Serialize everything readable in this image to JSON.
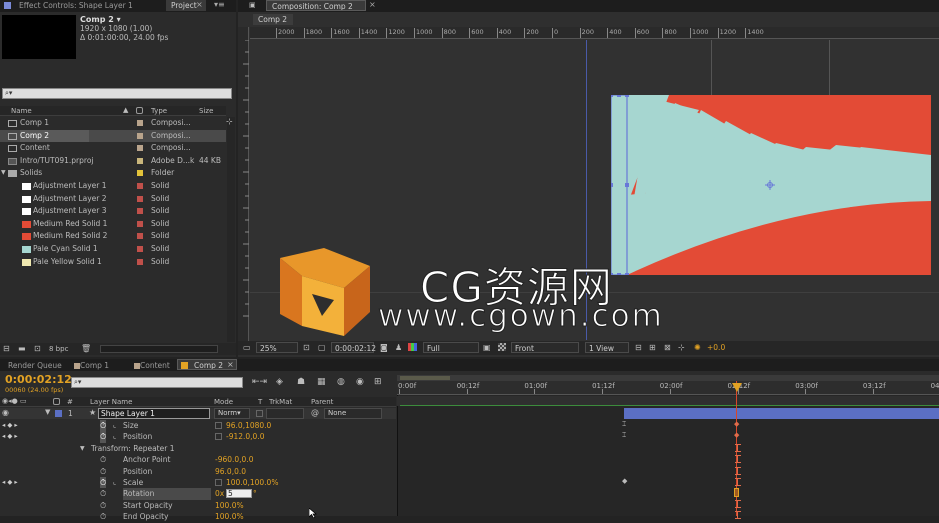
{
  "top_tabs": {
    "effect_controls": "Effect Controls: Shape Layer 1",
    "project": "Project",
    "composition": "Composition: Comp 2",
    "comp_subtab": "Comp 2"
  },
  "comp_info": {
    "name": "Comp 2 ▾",
    "resolution": "1920 x 1080 (1.00)",
    "duration": "Δ 0:01:00:00, 24.00 fps"
  },
  "project_search": {
    "placeholder": "⌕▾"
  },
  "project_columns": {
    "name": "Name",
    "type": "Type",
    "size": "Size"
  },
  "project_items": [
    {
      "name": "Comp 1",
      "type": "Composi...",
      "size": "",
      "swatch": "#b9a48c",
      "icon": "comp-icon",
      "indent": 0
    },
    {
      "name": "Comp 2",
      "type": "Composi...",
      "size": "",
      "swatch": "#b9a48c",
      "icon": "comp-icon",
      "indent": 0,
      "selected": true
    },
    {
      "name": "Content",
      "type": "Composi...",
      "size": "",
      "swatch": "#b9a48c",
      "icon": "comp-icon",
      "indent": 0
    },
    {
      "name": "Intro/TUT091.prproj",
      "type": "Adobe D...k",
      "size": "44 KB",
      "swatch": "#c9b67c",
      "icon": "project-file-icon",
      "indent": 0
    },
    {
      "name": "Solids",
      "type": "Folder",
      "size": "",
      "swatch": "#e3c33a",
      "icon": "folder-icon",
      "indent": 0
    },
    {
      "name": "Adjustment Layer 1",
      "type": "Solid",
      "size": "",
      "swatch": "#c0504a",
      "icon": "solid-white",
      "indent": 1
    },
    {
      "name": "Adjustment Layer 2",
      "type": "Solid",
      "size": "",
      "swatch": "#c0504a",
      "icon": "solid-white",
      "indent": 1
    },
    {
      "name": "Adjustment Layer 3",
      "type": "Solid",
      "size": "",
      "swatch": "#c0504a",
      "icon": "solid-white",
      "indent": 1
    },
    {
      "name": "Medium Red Solid 1",
      "type": "Solid",
      "size": "",
      "swatch": "#c0504a",
      "icon": "solid-red",
      "indent": 1
    },
    {
      "name": "Medium Red Solid 2",
      "type": "Solid",
      "size": "",
      "swatch": "#c0504a",
      "icon": "solid-red",
      "indent": 1
    },
    {
      "name": "Pale Cyan Solid 1",
      "type": "Solid",
      "size": "",
      "swatch": "#c0504a",
      "icon": "solid-cyan",
      "indent": 1
    },
    {
      "name": "Pale Yellow Solid 1",
      "type": "Solid",
      "size": "",
      "swatch": "#c0504a",
      "icon": "solid-yellow",
      "indent": 1
    }
  ],
  "project_footer": {
    "bpc": "8 bpc"
  },
  "ruler_labels": [
    "2000",
    "1800",
    "1600",
    "1400",
    "1200",
    "1000",
    "800",
    "600",
    "400",
    "200",
    "0",
    "200",
    "400",
    "600",
    "800",
    "1000",
    "1200",
    "1400"
  ],
  "viewer_bar": {
    "zoom": "25%",
    "timecode": "0:00:02:12",
    "resolution": "Full",
    "view": "Front",
    "views": "1 View",
    "exposure": "+0.0"
  },
  "watermark": {
    "line1": "CG资源网",
    "line2": "www.cgown.com"
  },
  "bottom_tabs": {
    "render_queue": "Render Queue",
    "comp1": "Comp 1",
    "content": "Content",
    "comp2": "Comp 2"
  },
  "timeline": {
    "timecode": "0:00:02:12",
    "frames": "00060 (24.00 fps)",
    "search_placeholder": "⌕▾"
  },
  "layer_columns": {
    "num": "#",
    "layer_name": "Layer Name",
    "mode": "Mode",
    "t": "T",
    "trkmat": "TrkMat",
    "parent": "Parent"
  },
  "layer": {
    "num": "1",
    "name": "Shape Layer 1",
    "mode": "Norm▾",
    "parent": "None"
  },
  "properties": [
    {
      "name": "Size",
      "value": "96.0,1080.0",
      "indent": 2,
      "stopwatch": true,
      "graph": true
    },
    {
      "name": "Position",
      "value": "-912.0,0.0",
      "indent": 2,
      "stopwatch": true,
      "graph": true
    },
    {
      "name": "Transform: Repeater 1",
      "value": "",
      "indent": 1,
      "group": true
    },
    {
      "name": "Anchor Point",
      "value": "-960.0,0.0",
      "indent": 2
    },
    {
      "name": "Position",
      "value": "96.0,0.0",
      "indent": 2
    },
    {
      "name": "Scale",
      "value": "100.0,100.0%",
      "indent": 2,
      "stopwatch": true,
      "graph": true
    },
    {
      "name": "Rotation",
      "value_prefix": "0x",
      "value_edit": "5",
      "value_suffix": "°",
      "indent": 2,
      "highlight": true
    },
    {
      "name": "Start Opacity",
      "value": "100.0%",
      "indent": 2
    },
    {
      "name": "End Opacity",
      "value": "100.0%",
      "indent": 2
    }
  ],
  "time_ruler": [
    "0:00f",
    "00:12f",
    "01:00f",
    "01:12f",
    "02:00f",
    "02:12f",
    "03:00f",
    "03:12f",
    "04:"
  ],
  "colors": {
    "accent": "#e2a224",
    "red_shape": "#e34b36",
    "cyan_shape": "#a6d6d0",
    "layer_bar": "#5b6fc4",
    "selection": "#6878d8"
  }
}
